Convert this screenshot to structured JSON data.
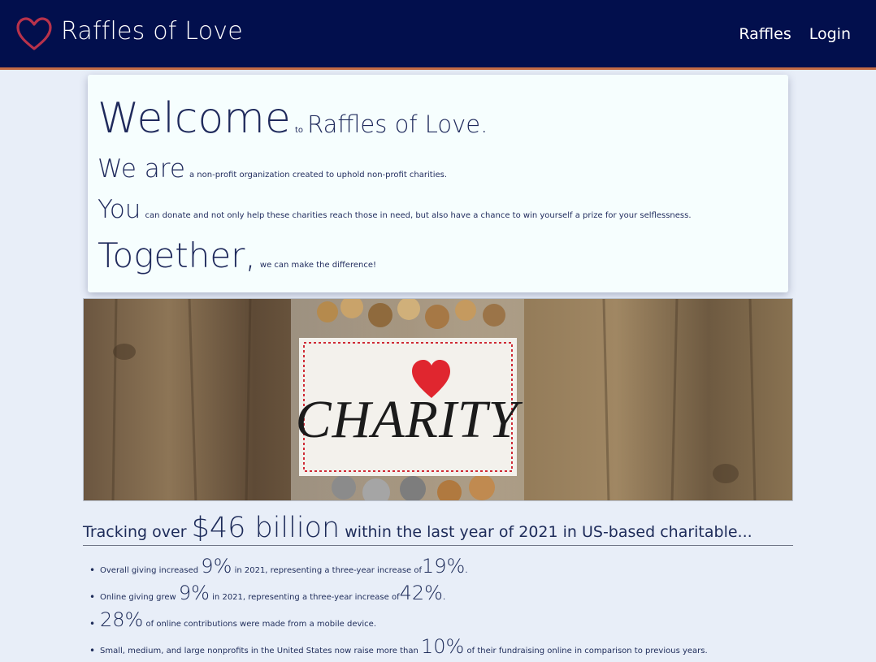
{
  "app": {
    "title": "Raffles of Love",
    "logo_icon": "heart-outline-icon"
  },
  "nav": {
    "items": [
      {
        "label": "Raffles"
      },
      {
        "label": "Login"
      }
    ]
  },
  "welcome": {
    "line1": {
      "big": "Welcome",
      "small": "to",
      "mid": "Raffles of Love."
    },
    "line2": {
      "big": "We are",
      "small": "a non-profit organization created to uphold non-profit charities."
    },
    "line3": {
      "big": "You",
      "small": "can donate and not only help these charities reach those in need, but also have a chance to win yourself a prize for your selflessness."
    },
    "line4": {
      "big": "Together,",
      "small": "we can make the difference!"
    }
  },
  "hero": {
    "label": "CHARITY"
  },
  "stats": {
    "title": {
      "prefix": "Tracking over",
      "amount": "$46 billion",
      "suffix": "within the last year of 2021 in US-based charitable..."
    },
    "items": [
      {
        "a": "Overall giving increased",
        "p1": "9%",
        "b": "in 2021, representing a three-year increase of",
        "p2": "19%",
        "c": "."
      },
      {
        "a": "Online giving grew",
        "p1": "9%",
        "b": "in 2021, representing a three-year increase of",
        "p2": "42%",
        "c": "."
      },
      {
        "a": "",
        "p1": "28%",
        "b": "of online contributions were made from a mobile device.",
        "p2": "",
        "c": ""
      },
      {
        "a": "Small, medium, and large nonprofits in the United States now raise more than",
        "p1": "10%",
        "b": "of their fundraising online in comparison to previous years.",
        "p2": "",
        "c": ""
      }
    ]
  }
}
